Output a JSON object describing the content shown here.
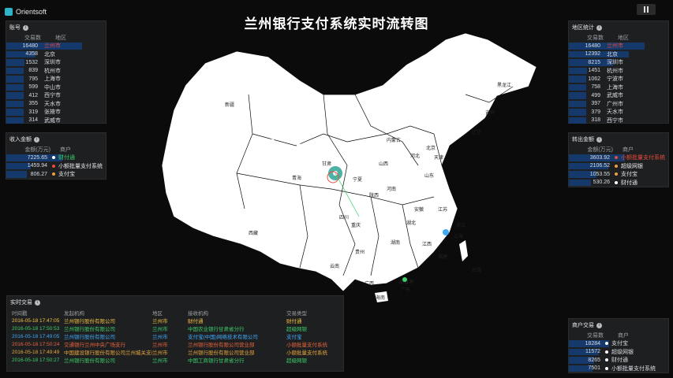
{
  "app": {
    "brand": "Orientsoft",
    "title": "兰州银行支付系统实时流转图"
  },
  "panel_top_left": {
    "title": "账号",
    "col_value": "交易数",
    "col_name": "地区",
    "rows": [
      {
        "value": "16480",
        "name": "兰州市",
        "pct": 1.0,
        "hl": "red"
      },
      {
        "value": "4358",
        "name": "北京",
        "pct": 0.26
      },
      {
        "value": "1532",
        "name": "深圳市",
        "pct": 0.09
      },
      {
        "value": "839",
        "name": "杭州市",
        "pct": 0.05
      },
      {
        "value": "795",
        "name": "上海市",
        "pct": 0.05
      },
      {
        "value": "599",
        "name": "中山市",
        "pct": 0.04
      },
      {
        "value": "412",
        "name": "西宁市",
        "pct": 0.03
      },
      {
        "value": "355",
        "name": "天水市",
        "pct": 0.02
      },
      {
        "value": "319",
        "name": "张掖市",
        "pct": 0.02
      },
      {
        "value": "314",
        "name": "武威市",
        "pct": 0.02
      }
    ]
  },
  "panel_mid_left": {
    "title": "收入金额",
    "col_value": "金额(万元)",
    "col_name": "商户",
    "rows": [
      {
        "value": "7225.65",
        "name": "财付通",
        "pct": 1.0,
        "dot": "#ffffff",
        "hl": "green"
      },
      {
        "value": "1459.94",
        "name": "小额批量支付系统",
        "pct": 0.2,
        "dot": "#e74c3c",
        "hl": "white"
      },
      {
        "value": "806.27",
        "name": "支付宝",
        "pct": 0.11,
        "dot": "#f0a040",
        "hl": "white"
      }
    ]
  },
  "panel_top_right": {
    "title": "地区统计",
    "col_value": "交易数",
    "col_name": "地区",
    "rows": [
      {
        "value": "16480",
        "name": "兰州市",
        "pct": 1.0,
        "hl": "red"
      },
      {
        "value": "12392",
        "name": "北京",
        "pct": 0.75
      },
      {
        "value": "8215",
        "name": "深圳市",
        "pct": 0.5
      },
      {
        "value": "1451",
        "name": "杭州市",
        "pct": 0.09
      },
      {
        "value": "1062",
        "name": "宁波市",
        "pct": 0.06
      },
      {
        "value": "758",
        "name": "上海市",
        "pct": 0.05
      },
      {
        "value": "499",
        "name": "武威市",
        "pct": 0.03
      },
      {
        "value": "397",
        "name": "广州市",
        "pct": 0.02
      },
      {
        "value": "379",
        "name": "天水市",
        "pct": 0.02
      },
      {
        "value": "318",
        "name": "西宁市",
        "pct": 0.02
      }
    ]
  },
  "panel_mid_right": {
    "title": "转出金额",
    "col_value": "金额(万元)",
    "col_name": "商户",
    "rows": [
      {
        "value": "3603.92",
        "name": "小额批量支付系统",
        "pct": 1.0,
        "dot": "#e74c3c",
        "hl": "red"
      },
      {
        "value": "2106.52",
        "name": "超级网银",
        "pct": 0.58,
        "dot": "#f0a040",
        "hl": "white"
      },
      {
        "value": "1053.55",
        "name": "支付宝",
        "pct": 0.29,
        "dot": "#f0a040",
        "hl": "white"
      },
      {
        "value": "530.26",
        "name": "财付通",
        "pct": 0.15,
        "dot": "#ffffff",
        "hl": "white"
      }
    ]
  },
  "panel_bottom_right": {
    "title": "商户交易",
    "col_value": "交易数",
    "col_name": "商户",
    "rows": [
      {
        "value": "18284",
        "name": "支付宝",
        "pct": 1.0,
        "dot": "#ffffff"
      },
      {
        "value": "11572",
        "name": "超级网银",
        "pct": 0.63,
        "dot": "#ffffff"
      },
      {
        "value": "8265",
        "name": "财付通",
        "pct": 0.45,
        "dot": "#ffffff"
      },
      {
        "value": "7501",
        "name": "小额批量支付系统",
        "pct": 0.41,
        "dot": "#ffffff"
      }
    ]
  },
  "transactions": {
    "title": "实时交易",
    "headers": [
      "时间戳",
      "发起机构",
      "地区",
      "接收机构",
      "交易类型"
    ],
    "rows": [
      {
        "time": "2016-05-18 17:47:05",
        "from": "兰州银行股份有限公司",
        "region": "兰州市",
        "to": "财付通",
        "type": "财付通",
        "color": "#f0c040"
      },
      {
        "time": "2016-05-18 17:50:53",
        "from": "兰州银行股份有限公司",
        "region": "兰州市",
        "to": "中国农业银行甘肃省分行",
        "type": "超级网银",
        "color": "#3ccf6a"
      },
      {
        "time": "2016-05-18 17:49:05",
        "from": "兰州银行股份有限公司",
        "region": "兰州市",
        "to": "支付宝(中国)网络技术有限公司",
        "type": "支付宝",
        "color": "#3fa9f5"
      },
      {
        "time": "2016-05-18 17:50:24",
        "from": "交通银行兰州中央广场支行",
        "region": "兰州市",
        "to": "兰州银行股份有限公司营业部",
        "type": "小额批量支付系统",
        "color": "#e8643c"
      },
      {
        "time": "2016-05-18 17:49:49",
        "from": "中国建设银行股份有限公司兰州城关支行",
        "region": "兰州市",
        "to": "兰州银行股份有限公司营业部",
        "type": "小额批量支付系统",
        "color": "#e8a83c"
      },
      {
        "time": "2016-05-18 17:50:27",
        "from": "兰州银行股份有限公司",
        "region": "兰州市",
        "to": "中国工商银行甘肃省分行",
        "type": "超级网银",
        "color": "#3ccf6a"
      }
    ]
  },
  "map_labels": [
    "新疆",
    "西藏",
    "青海",
    "甘肃",
    "四川",
    "云南",
    "贵州",
    "广西",
    "广东",
    "湖南",
    "江西",
    "福建",
    "浙江",
    "江苏",
    "安徽",
    "湖北",
    "河南",
    "山西",
    "陕西",
    "宁夏",
    "内蒙古",
    "河北",
    "北京",
    "天津",
    "山东",
    "辽宁",
    "吉林",
    "黑龙江",
    "海南",
    "台湾",
    "重庆",
    "上海",
    "香港",
    "澳门"
  ]
}
